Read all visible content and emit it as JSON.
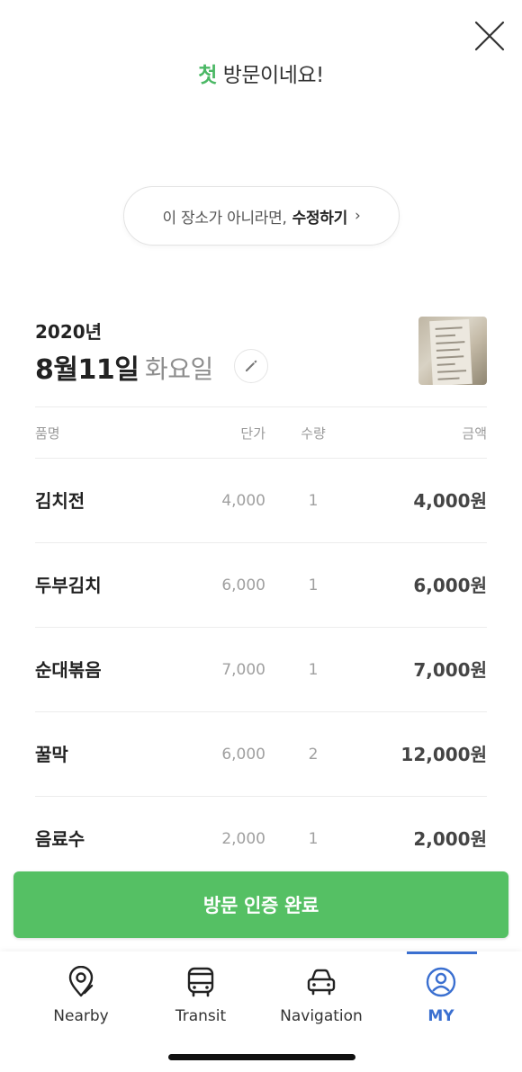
{
  "header": {
    "headline_accent": "첫",
    "headline_rest": "방문이네요!"
  },
  "location": {
    "prompt": "이 장소가 아니라면,",
    "edit_label": "수정하기",
    "chevron": "›"
  },
  "visit_date": {
    "year": "2020년",
    "day": "8월11일",
    "weekday": "화요일"
  },
  "table": {
    "headers": {
      "name": "품명",
      "price": "단가",
      "qty": "수량",
      "amount": "금액"
    },
    "rows": [
      {
        "name": "김치전",
        "price": "4,000",
        "qty": "1",
        "amount": "4,000원"
      },
      {
        "name": "두부김치",
        "price": "6,000",
        "qty": "1",
        "amount": "6,000원"
      },
      {
        "name": "순대볶음",
        "price": "7,000",
        "qty": "1",
        "amount": "7,000원"
      },
      {
        "name": "꿀막",
        "price": "6,000",
        "qty": "2",
        "amount": "12,000원"
      },
      {
        "name": "음료수",
        "price": "2,000",
        "qty": "1",
        "amount": "2,000원"
      }
    ]
  },
  "confirm_button": {
    "label": "방문 인증 완료"
  },
  "bottom_nav": {
    "tabs": [
      {
        "label": "Nearby",
        "icon": "map-pin-icon",
        "active": false
      },
      {
        "label": "Transit",
        "icon": "bus-icon",
        "active": false
      },
      {
        "label": "Navigation",
        "icon": "car-icon",
        "active": false
      },
      {
        "label": "MY",
        "icon": "user-circle-icon",
        "active": true
      }
    ]
  },
  "colors": {
    "accent_green": "#4bb865",
    "button_green": "#55c064",
    "nav_active_blue": "#3a6fd0"
  }
}
